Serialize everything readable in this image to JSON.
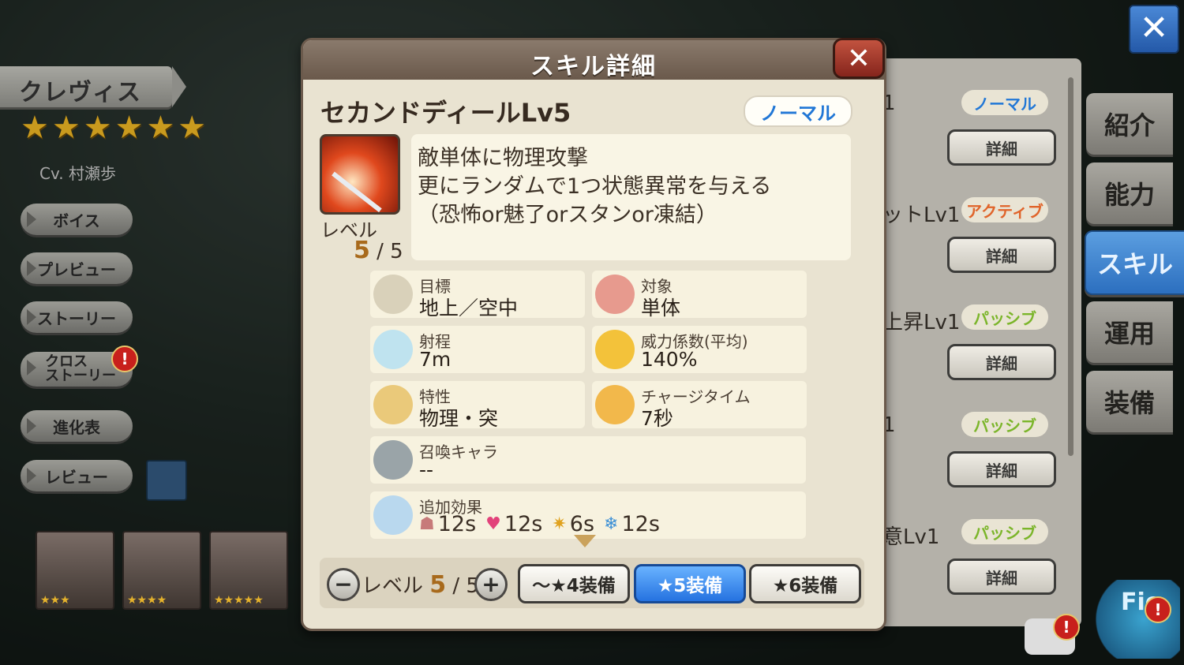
{
  "character": {
    "name": "クレヴィス",
    "stars": [
      "★",
      "★",
      "★",
      "★",
      "★",
      "★"
    ],
    "cv": "Cv. 村瀬歩"
  },
  "side_menu": [
    {
      "label": "ボイス"
    },
    {
      "label": "プレビュー"
    },
    {
      "label": "ストーリー"
    },
    {
      "label_line1": "クロス",
      "label_line2": "ストーリー",
      "alert": "!"
    },
    {
      "label": "進化表"
    },
    {
      "label": "レビュー"
    }
  ],
  "portraits": [
    {
      "stars": "★★★"
    },
    {
      "stars": "★★★★"
    },
    {
      "stars": "★★★★★"
    }
  ],
  "right_tabs": [
    {
      "label": "紹介",
      "active": false
    },
    {
      "label": "能力",
      "active": false
    },
    {
      "label": "スキル",
      "active": true
    },
    {
      "label": "運用",
      "active": false
    },
    {
      "label": "装備",
      "active": false
    }
  ],
  "skill_list": [
    {
      "name": "1",
      "badge": "ノーマル",
      "badge_color": "#2177d6",
      "detail": "詳細"
    },
    {
      "name": "ットLv1",
      "badge": "アクティブ",
      "badge_color": "#e0642a",
      "detail": "詳細"
    },
    {
      "name": "上昇Lv1",
      "badge": "パッシブ",
      "badge_color": "#7bb52a",
      "detail": "詳細"
    },
    {
      "name": "1",
      "badge": "パッシブ",
      "badge_color": "#7bb52a",
      "detail": "詳細"
    },
    {
      "name": "意Lv1",
      "badge": "パッシブ",
      "badge_color": "#7bb52a",
      "detail": "詳細"
    }
  ],
  "top_close": "✕",
  "fio_text": "Fio",
  "fio_alert": "!",
  "chat_alert": "!",
  "dialog": {
    "title": "スキル詳細",
    "close": "✕",
    "skill_name": "セカンドディールLv5",
    "type_badge": "ノーマル",
    "level_label": "レベル",
    "level_current": "5",
    "level_rest": " / 5",
    "description": [
      "敵単体に物理攻撃",
      "更にランダムで1つ状態異常を与える",
      "（恐怖or魅了orスタンor凍結）"
    ],
    "stats": {
      "target": {
        "label": "目標",
        "value": "地上／空中"
      },
      "scope": {
        "label": "対象",
        "value": "単体"
      },
      "range": {
        "label": "射程",
        "value": "7m"
      },
      "power": {
        "label": "威力係数(平均)",
        "value": "140%"
      },
      "attribute": {
        "label": "特性",
        "value": "物理・突"
      },
      "charge": {
        "label": "チャージタイム",
        "value": "7秒"
      },
      "summon": {
        "label": "召喚キャラ",
        "value": "--"
      },
      "extra": {
        "label": "追加効果",
        "effects": [
          {
            "icon": "fear-icon",
            "value": "12s"
          },
          {
            "icon": "charm-icon",
            "value": "12s"
          },
          {
            "icon": "stun-icon",
            "value": "6s"
          },
          {
            "icon": "freeze-icon",
            "value": "12s"
          }
        ]
      }
    },
    "bottom": {
      "minus": "−",
      "plus": "+",
      "level_label": "レベル ",
      "level_current": "5",
      "level_rest": " / 5",
      "buttons": [
        {
          "label": "〜★4装備",
          "active": false
        },
        {
          "label": "★5装備",
          "active": true
        },
        {
          "label": "★6装備",
          "active": false
        }
      ]
    }
  }
}
